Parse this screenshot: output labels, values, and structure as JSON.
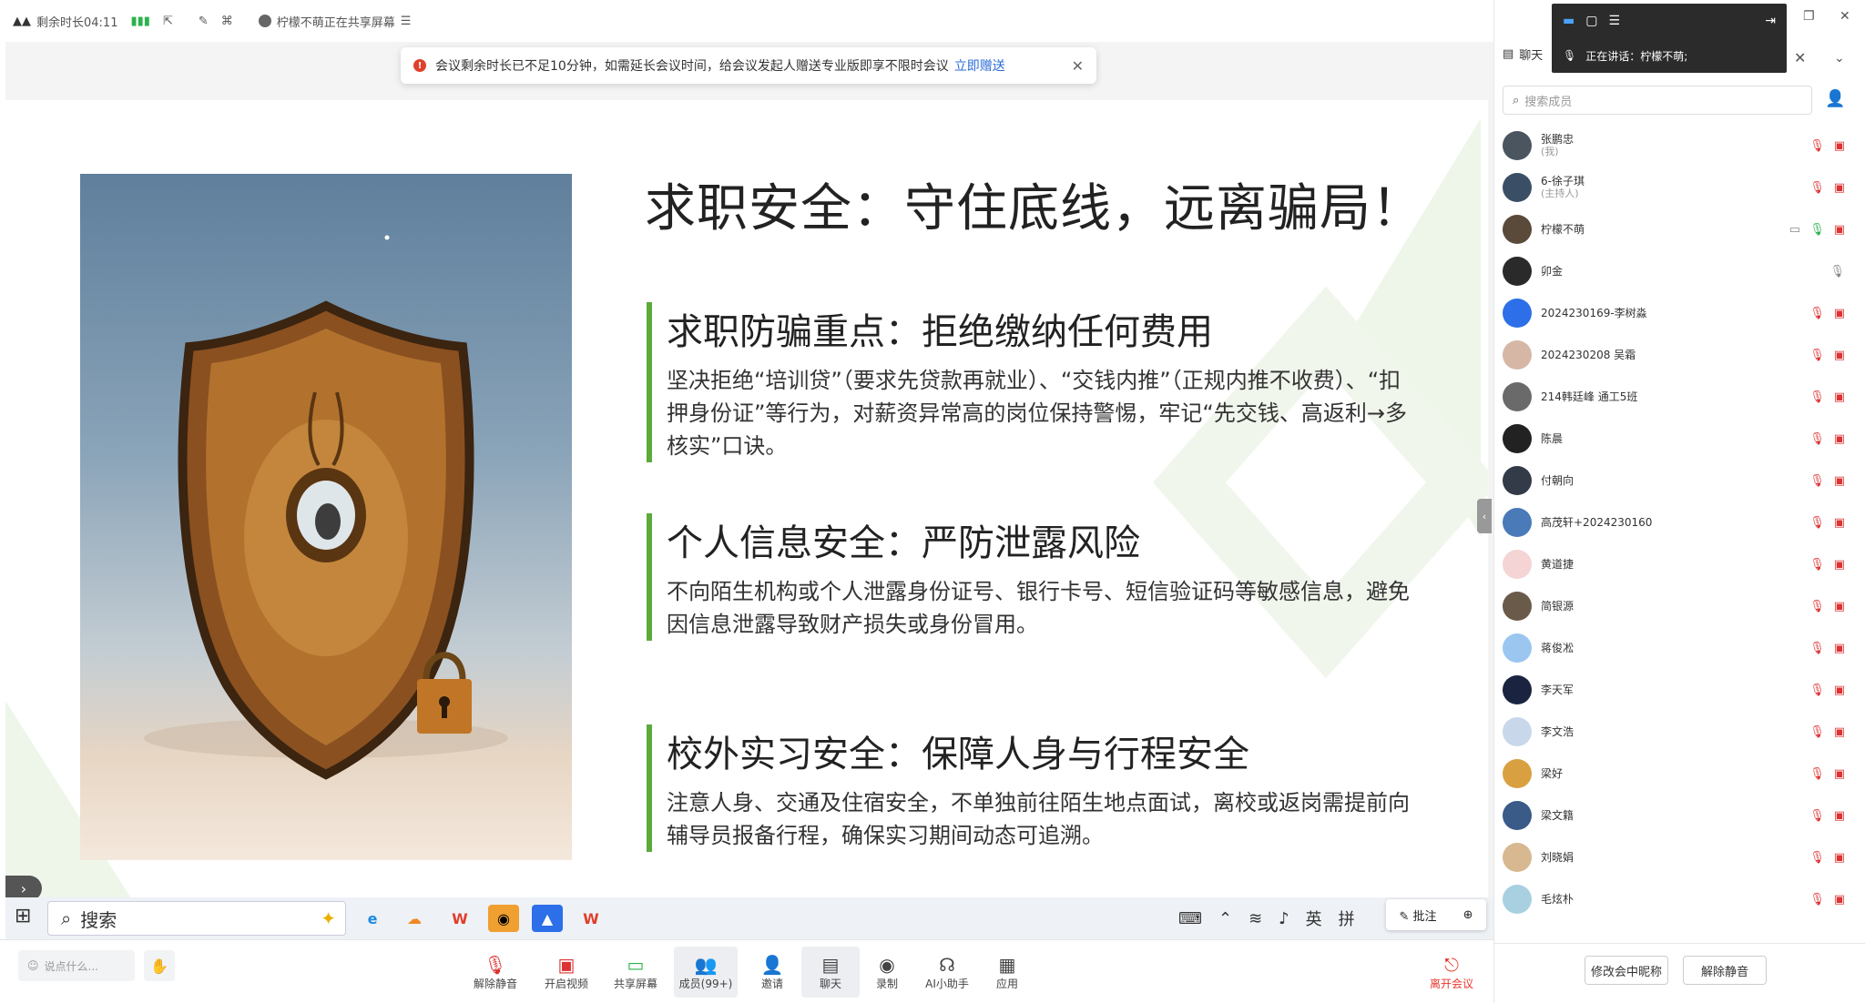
{
  "topbar": {
    "time_remaining": "剩余时长04:11",
    "sharing_status": "柠檬不萌正在共享屏幕"
  },
  "notice": {
    "text": "会议剩余时长已不足10分钟，如需延长会议时间，给会议发起人赠送专业版即享不限时会议",
    "link": "立即赠送"
  },
  "slide": {
    "title": "求职安全：守住底线，远离骗局！",
    "sections": [
      {
        "heading": "求职防骗重点：拒绝缴纳任何费用",
        "body": "坚决拒绝“培训贷”（要求先贷款再就业）、“交钱内推”（正规内推不收费）、“扣押身份证”等行为，对薪资异常高的岗位保持警惕，牢记“先交钱、高返利→多核实”口诀。"
      },
      {
        "heading": "个人信息安全：严防泄露风险",
        "body": "不向陌生机构或个人泄露身份证号、银行卡号、短信验证码等敏感信息，避免因信息泄露导致财产损失或身份冒用。"
      },
      {
        "heading": "校外实习安全：保障人身与行程安全",
        "body": "注意人身、交通及住宿安全，不单独前往陌生地点面试，离校或返岗需提前向辅导员报备行程，确保实习期间动态可追溯。"
      }
    ]
  },
  "taskbar": {
    "search_label": "搜索",
    "ime_lang": "英",
    "ime_mode": "拼",
    "annotate": "批注"
  },
  "controls": {
    "chat_placeholder": "说点什么...",
    "unmute": "解除静音",
    "video": "开启视频",
    "share": "共享屏幕",
    "members": "成员(99+)",
    "invite": "邀请",
    "chat": "聊天",
    "record": "录制",
    "ai": "AI小助手",
    "apps": "应用",
    "leave": "离开会议"
  },
  "panel": {
    "tab_chat": "聊天",
    "speaking": "正在讲话：柠檬不萌;",
    "search_placeholder": "搜索成员",
    "rename_button": "修改会中昵称",
    "unmute_button": "解除静音",
    "members": [
      {
        "name": "张鹏忠",
        "role": "(我)"
      },
      {
        "name": "6-徐子琪",
        "role": "(主持人)"
      },
      {
        "name": "柠檬不萌",
        "role": ""
      },
      {
        "name": "卯金",
        "role": ""
      },
      {
        "name": "2024230169-李树淼",
        "role": ""
      },
      {
        "name": "2024230208 吴霜",
        "role": ""
      },
      {
        "name": "214韩廷峰 通工5班",
        "role": ""
      },
      {
        "name": "陈晨",
        "role": ""
      },
      {
        "name": "付朝向",
        "role": ""
      },
      {
        "name": "高茂轩+2024230160",
        "role": ""
      },
      {
        "name": "黄道捷",
        "role": ""
      },
      {
        "name": "简银源",
        "role": ""
      },
      {
        "name": "蒋俊凇",
        "role": ""
      },
      {
        "name": "李天军",
        "role": ""
      },
      {
        "name": "李文浩",
        "role": ""
      },
      {
        "name": "梁好",
        "role": ""
      },
      {
        "name": "梁文籍",
        "role": ""
      },
      {
        "name": "刘晓娟",
        "role": ""
      },
      {
        "name": "毛炫朴",
        "role": ""
      }
    ]
  }
}
